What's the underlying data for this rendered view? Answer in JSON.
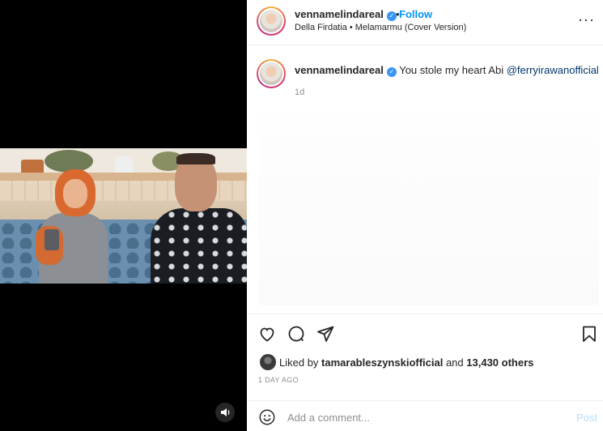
{
  "media": {
    "audio_icon": "speaker-icon"
  },
  "header": {
    "username": "vennamelindareal",
    "separator": "•",
    "follow_label": "Follow",
    "audio_info": "Della Firdatia • Melamarmu (Cover Version)",
    "more_icon": "more-horizontal-icon",
    "more_label": "···"
  },
  "caption": {
    "username": "vennamelindareal",
    "text": "You stole my heart Abi ",
    "mention": "@ferryirawanofficial",
    "time": "1d"
  },
  "actions": {
    "icons": [
      "heart-icon",
      "comment-icon",
      "share-icon",
      "bookmark-icon"
    ]
  },
  "likes": {
    "prefix": "Liked by ",
    "user": "tamarableszynskiofficial",
    "middle": " and ",
    "count": "13,430 others"
  },
  "date": "1 DAY AGO",
  "comment": {
    "placeholder": "Add a comment...",
    "post_label": "Post"
  },
  "colors": {
    "accent": "#0095f6",
    "verified": "#3897f0",
    "post_disabled": "#b2dffc"
  }
}
